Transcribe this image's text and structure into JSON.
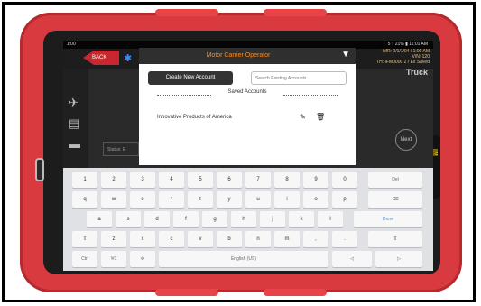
{
  "device": {
    "statusbar": {
      "left": "1:00",
      "right": "5 ↑ 21% ▮ 11:01 AM"
    },
    "appbar": {
      "back_label": "BACK",
      "info_right": [
        "IMR: 0/1/1/04 / 1:00 AM",
        "V/N: 120",
        "TH: IFM0000 2 / Ex Saved"
      ],
      "truck_label": "Truck"
    },
    "status_chip": "Status: E",
    "next_label": "Next",
    "right_logo": "IM"
  },
  "dialog": {
    "title": "Motor Carrier Operator",
    "create_button": "Create New Account",
    "search_placeholder": "Search Existing Accounts",
    "saved_label": "Saved Accounts",
    "accounts": [
      {
        "name": "Innovative Products of America"
      }
    ]
  },
  "keyboard": {
    "row1": [
      "1",
      "2",
      "3",
      "4",
      "5",
      "6",
      "7",
      "8",
      "9",
      "0",
      "Del"
    ],
    "row2": [
      "q",
      "w",
      "e",
      "r",
      "t",
      "y",
      "u",
      "i",
      "o",
      "p",
      "⌫"
    ],
    "row3": [
      "a",
      "s",
      "d",
      "f",
      "g",
      "h",
      "j",
      "k",
      "l",
      "Done"
    ],
    "row4": [
      "⇧",
      "z",
      "x",
      "c",
      "v",
      "b",
      "n",
      "m",
      ",",
      ".",
      "⇧"
    ],
    "row5": [
      "Ctrl",
      "!#1",
      "⚙",
      "English (US)",
      "◁",
      "▷"
    ]
  }
}
